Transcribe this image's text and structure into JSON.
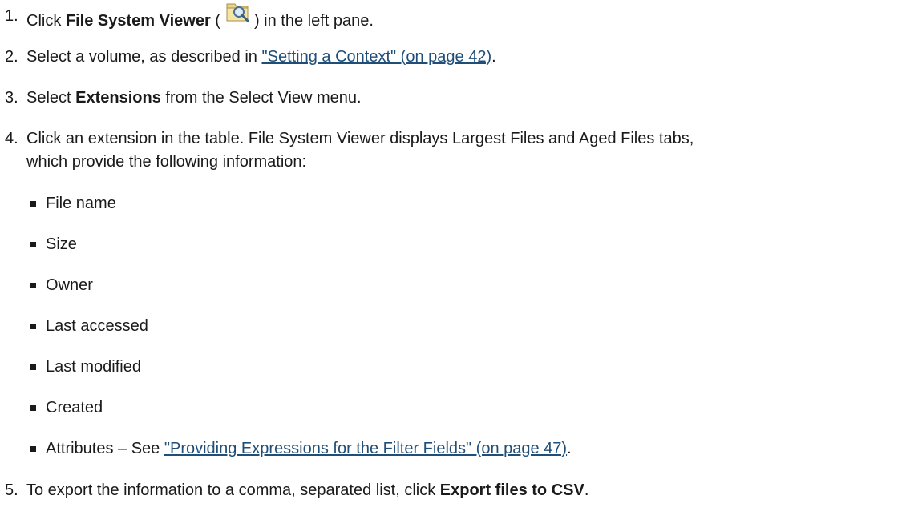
{
  "steps": [
    {
      "number": "1.",
      "pre": "Click ",
      "bold": "File System Viewer",
      "mid": " (",
      "post": ") in the left pane.",
      "icon": "file-system-viewer-icon"
    },
    {
      "number": "2.",
      "pre": "Select a volume, as described in ",
      "link": "\"Setting a Context\" (on page 42)",
      "post": "."
    },
    {
      "number": "3.",
      "pre": "Select ",
      "bold": "Extensions",
      "post": " from the Select View menu."
    },
    {
      "number": "4.",
      "line1": "Click an extension in the table. File System Viewer displays Largest Files and Aged Files tabs,",
      "line2": "which provide the following information:"
    },
    {
      "number": "5.",
      "pre": "To export the information to a comma, separated list, click ",
      "bold": "Export files to CSV",
      "post": "."
    }
  ],
  "bullets": [
    "File name",
    "Size",
    "Owner",
    "Last accessed",
    "Last modified",
    "Created"
  ],
  "attributes_item": {
    "pre": "Attributes – See ",
    "link": "\"Providing Expressions for the Filter Fields\" (on page 47)",
    "post": "."
  },
  "colors": {
    "text": "#1a1a1a",
    "link": "#1f4e79"
  }
}
